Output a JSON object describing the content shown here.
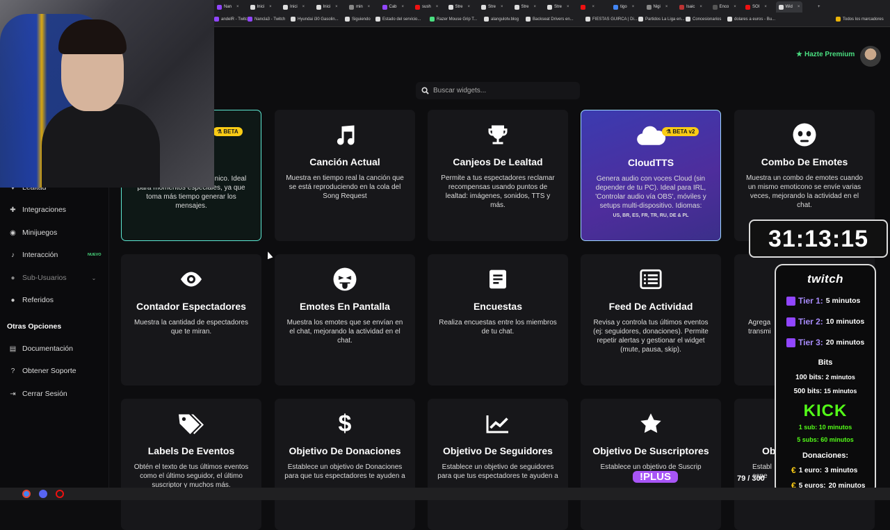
{
  "tabs": [
    {
      "label": "Nan"
    },
    {
      "label": "Inici"
    },
    {
      "label": "Inici"
    },
    {
      "label": "Inici"
    },
    {
      "label": "min"
    },
    {
      "label": "Cab"
    },
    {
      "label": "sush"
    },
    {
      "label": "Stre"
    },
    {
      "label": "Stre"
    },
    {
      "label": "Stre"
    },
    {
      "label": "Stre"
    },
    {
      "label": ""
    },
    {
      "label": "tigo"
    },
    {
      "label": "Nigi"
    },
    {
      "label": "Isaic"
    },
    {
      "label": "Enco"
    },
    {
      "label": "SOI"
    },
    {
      "label": "Wid"
    }
  ],
  "bookmarks": [
    {
      "label": "andelR - Twitch"
    },
    {
      "label": "Nancla3 - Twitch"
    },
    {
      "label": "Hyundai i30 Gasolin..."
    },
    {
      "label": "Siguiendo"
    },
    {
      "label": "Estado del servicio..."
    },
    {
      "label": "Razer Mouse Grip T..."
    },
    {
      "label": "alangulotv.blog"
    },
    {
      "label": "Backseat Drivers en..."
    },
    {
      "label": "FIESTAS GUIRCA | Di..."
    },
    {
      "label": "Partidos La Liga en..."
    },
    {
      "label": "Concesionarios"
    },
    {
      "label": "dolares a euros - Bu..."
    },
    {
      "label": "Todos los marcadores"
    }
  ],
  "header": {
    "premium_label": "Hazte Premium"
  },
  "search": {
    "placeholder": "Buscar widgets..."
  },
  "sidebar": {
    "items": [
      {
        "label": "Lealtad",
        "icon": "heart-icon"
      },
      {
        "label": "Integraciones",
        "icon": "puzzle-icon"
      },
      {
        "label": "Minijuegos",
        "icon": "gamepad-icon"
      },
      {
        "label": "Interacción",
        "icon": "music-icon",
        "badge": "NUEVO"
      },
      {
        "label": "Sub-Usuarios",
        "icon": "users-icon"
      },
      {
        "label": "Referidos",
        "icon": "users-icon"
      }
    ],
    "section_title": "Otras Opciones",
    "other_items": [
      {
        "label": "Documentación",
        "icon": "book-icon"
      },
      {
        "label": "Obtener Soporte",
        "icon": "help-icon"
      },
      {
        "label": "Cerrar Sesión",
        "icon": "logout-icon"
      }
    ]
  },
  "cards": {
    "ai": {
      "badge": "BETA",
      "desc": "on IA para dar un toque único. Ideal para momentos especiales, ya que toma más tiempo generar los mensajes."
    },
    "cancion": {
      "title": "Canción Actual",
      "desc": "Muestra en tiempo real la canción que se está reproduciendo en la cola del Song Request"
    },
    "canjeos": {
      "title": "Canjeos De Lealtad",
      "desc": "Permite a tus espectadores reclamar recompensas usando puntos de lealtad: imágenes, sonidos, TTS y más."
    },
    "cloudtts": {
      "title": "CloudTTS",
      "badge": "BETA v2",
      "desc": "Genera audio con voces Cloud (sin depender de tu PC). Ideal para IRL, 'Controlar audio vía OBS', móviles y setups multi-dispositivo. Idiomas:",
      "langs": "US, BR, ES, FR, TR, RU, DE & PL"
    },
    "combo": {
      "title": "Combo De Emotes",
      "desc": "Muestra un combo de emotes cuando un mismo emoticono se envíe varias veces, mejorando la actividad en el chat."
    },
    "contador": {
      "title": "Contador Espectadores",
      "desc": "Muestra la cantidad de espectadores que te miran."
    },
    "emotes": {
      "title": "Emotes En Pantalla",
      "desc": "Muestra los emotes que se envían en el chat, mejorando la actividad en el chat."
    },
    "encuestas": {
      "title": "Encuestas",
      "desc": "Realiza encuestas entre los miembros de tu chat."
    },
    "feed": {
      "title": "Feed De Actividad",
      "desc": "Revisa y controla tus últimos eventos (ej: seguidores, donaciones). Permite repetir alertas y gestionar el widget (mute, pausa, skip)."
    },
    "partial": {
      "desc": "Agrega\ntransmi"
    },
    "labels": {
      "title": "Labels De Eventos",
      "desc": "Obtén el texto de tus últimos eventos como el último seguidor, el último suscriptor y muchos más."
    },
    "donaciones": {
      "title": "Objetivo De Donaciones",
      "desc": "Establece un objetivo de Donaciones para que tus espectadores te ayuden a"
    },
    "seguidores": {
      "title": "Objetivo De Seguidores",
      "desc": "Establece un objetivo de seguidores para que tus espectadores te ayuden a"
    },
    "suscriptores": {
      "title": "Objetivo De Suscriptores",
      "desc": "Establece un objetivo de Suscrip"
    },
    "ob_partial": {
      "title": "Ob",
      "desc": "Establ\nespe"
    }
  },
  "overlay": {
    "timer": "31:13:15",
    "twitch_logo": "twitch",
    "tiers": [
      {
        "label": "Tier 1:",
        "mins": "5 minutos"
      },
      {
        "label": "Tier 2:",
        "mins": "10 minutos"
      },
      {
        "label": "Tier 3:",
        "mins": "20 minutos"
      }
    ],
    "bits_title": "Bits",
    "bits": [
      {
        "bold": "100 bits:",
        "rest": "2 minutos"
      },
      {
        "bold": "500 bits:",
        "rest": "15 minutos"
      }
    ],
    "kick_logo": "KICK",
    "kick": [
      "1 sub: 10 minutos",
      "5 subs: 60 minutos"
    ],
    "don_title": "Donaciones:",
    "donations": [
      {
        "label": "1 euro:",
        "mins": "3 minutos"
      },
      {
        "label": "5 euros:",
        "mins": "20 minutos"
      }
    ],
    "plus": "!PLUS",
    "counter": "79 / 300"
  },
  "colors": {
    "accent": "#4ade80",
    "twitch": "#9146ff",
    "kick": "#53fc18",
    "beta": "#facc15"
  }
}
